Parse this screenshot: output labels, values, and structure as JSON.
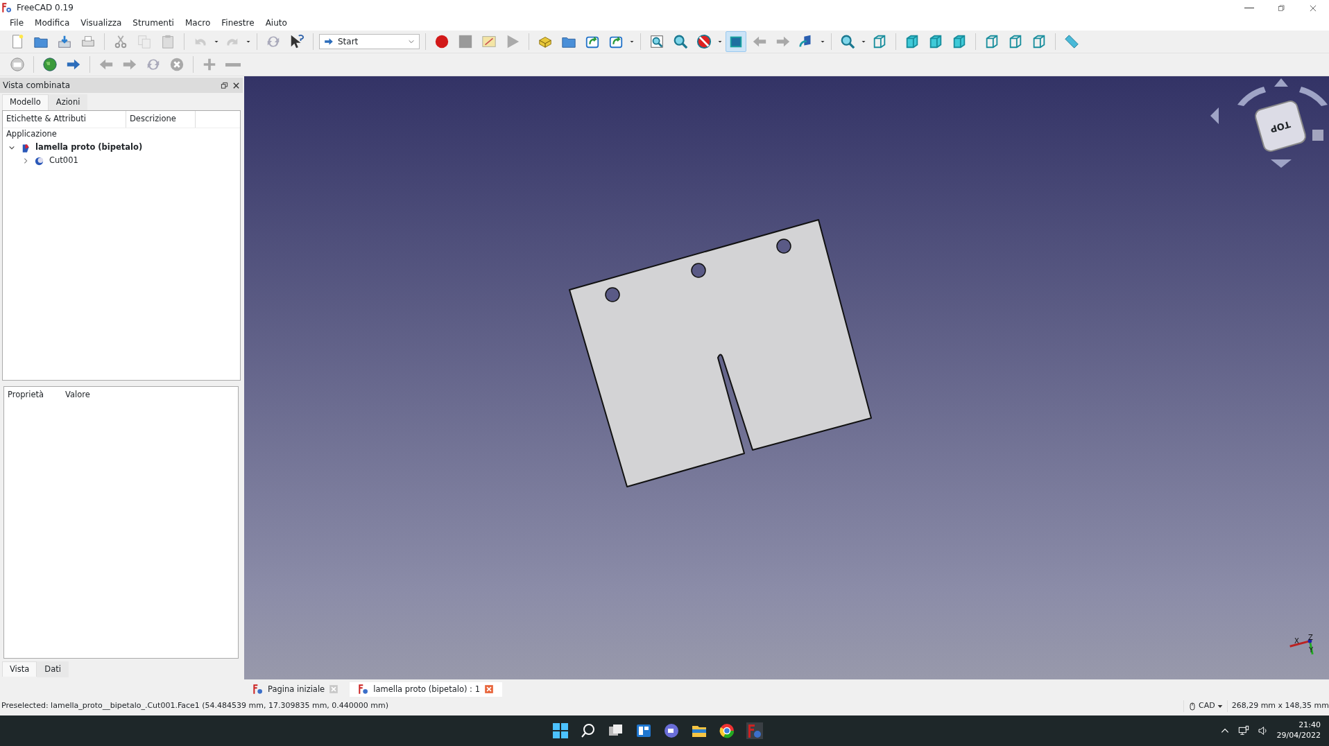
{
  "window": {
    "title": "FreeCAD 0.19"
  },
  "menu": [
    "File",
    "Modifica",
    "Visualizza",
    "Strumenti",
    "Macro",
    "Finestre",
    "Aiuto"
  ],
  "workbench_selector": {
    "value": "Start"
  },
  "panel": {
    "title": "Vista combinata",
    "tabs": [
      {
        "label": "Modello",
        "selected": true
      },
      {
        "label": "Azioni",
        "selected": false
      }
    ],
    "tree_columns": [
      "Etichette & Attributi",
      "Descrizione"
    ],
    "tree_root": "Applicazione",
    "tree": [
      {
        "label": "lamella proto (bipetalo)",
        "expanded": true,
        "children": [
          {
            "label": "Cut001",
            "expanded": false
          }
        ]
      }
    ],
    "property_columns": [
      "Proprietà",
      "Valore"
    ],
    "bottom_tabs": [
      {
        "label": "Vista",
        "selected": true
      },
      {
        "label": "Dati",
        "selected": false
      }
    ]
  },
  "view": {
    "navcube_face": "TOP",
    "axes": [
      "X",
      "Z",
      "Y"
    ]
  },
  "document_tabs": [
    {
      "label": "Pagina iniziale",
      "selected": false
    },
    {
      "label": "lamella proto (bipetalo) : 1",
      "selected": true
    }
  ],
  "status_bar": {
    "message": "Preselected: lamella_proto__bipetalo_.Cut001.Face1 (54.484539 mm, 17.309835 mm, 0.440000 mm)",
    "navigation_style": "CAD",
    "dimensions": "268,29 mm x 148,35 mm"
  },
  "taskbar": {
    "time": "21:40",
    "date": "29/04/2022"
  }
}
